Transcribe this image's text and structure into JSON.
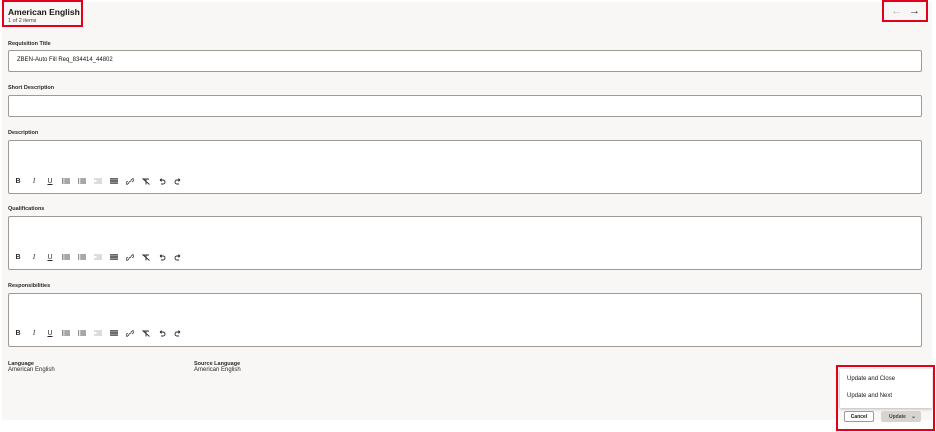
{
  "header": {
    "title": "American English",
    "subtitle": "1 of 2 items",
    "prev_icon": "←",
    "next_icon": "→"
  },
  "fields": {
    "requisition_title": {
      "label": "Requisition Title",
      "value": "ZBEN-Auto Fill Req_834414_44802"
    },
    "short_description": {
      "label": "Short Description",
      "value": ""
    },
    "description": {
      "label": "Description"
    },
    "qualifications": {
      "label": "Qualifications"
    },
    "responsibilities": {
      "label": "Responsibilities"
    }
  },
  "toolbar": {
    "bold": "B",
    "italic": "I",
    "underline": "U",
    "items": [
      "bold-icon",
      "italic-icon",
      "underline-icon",
      "bulleted-list-icon",
      "numbered-list-icon",
      "outdent-icon",
      "indent-icon",
      "link-icon",
      "clear-format-icon",
      "undo-icon",
      "redo-icon"
    ]
  },
  "meta": {
    "language_label": "Language",
    "language_value": "American English",
    "source_label": "Source Language",
    "source_value": "American English"
  },
  "menu": {
    "update_close": "Update and Close",
    "update_next": "Update and Next"
  },
  "buttons": {
    "cancel": "Cancel",
    "update": "Update"
  },
  "colors": {
    "highlight": "#e3001b",
    "background": "#f8f7f5"
  }
}
